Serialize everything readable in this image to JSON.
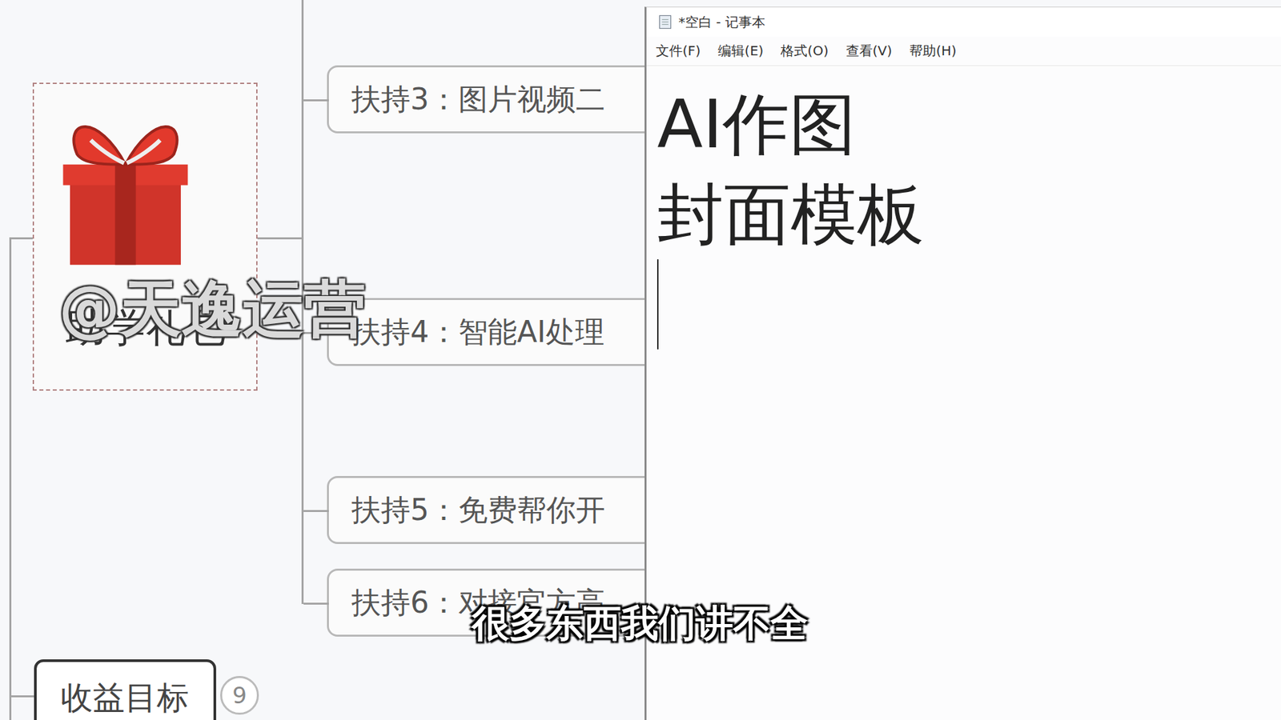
{
  "mindmap": {
    "root": {
      "label": "助学礼包"
    },
    "branches": [
      {
        "label": "扶持3：图片视频二"
      },
      {
        "label": "扶持4：智能AI处理"
      },
      {
        "label": "扶持5：免费帮你开"
      },
      {
        "label": "扶持6：对接官方高"
      }
    ],
    "goal": {
      "label": "收益目标",
      "badge": "9"
    }
  },
  "watermark": "@天逸运营",
  "subtitle": "很多东西我们讲不全",
  "notepad": {
    "title": "*空白 - 记事本",
    "menu": [
      "文件(F)",
      "编辑(E)",
      "格式(O)",
      "查看(V)",
      "帮助(H)"
    ],
    "lines": [
      "AI作图",
      "封面模板"
    ]
  }
}
